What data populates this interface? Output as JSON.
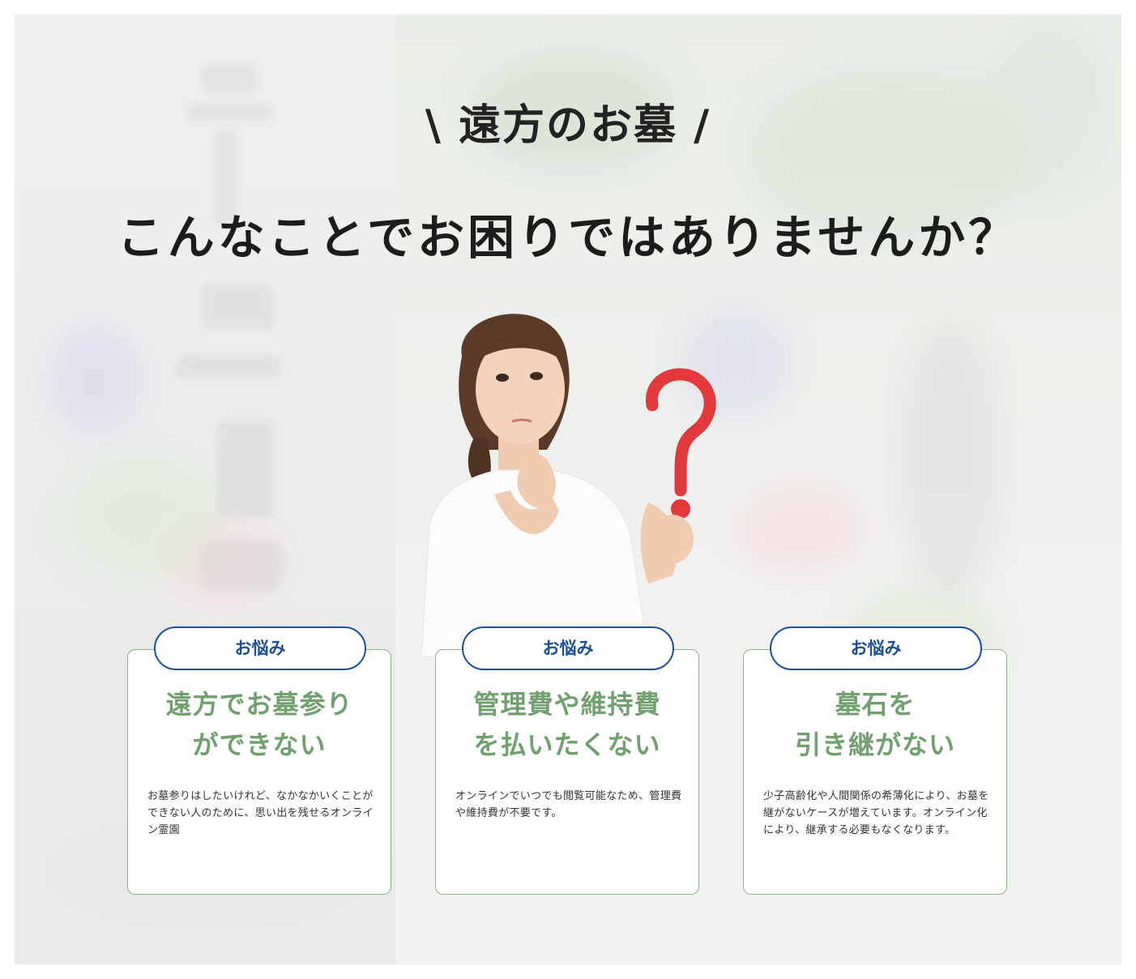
{
  "section": {
    "kicker": "\\ 遠方のお墓 /",
    "headline": "こんなことでお困りではありませんか？"
  },
  "cards": [
    {
      "tag": "お悩み",
      "title_line1": "遠方でお墓参り",
      "title_line2": "ができない",
      "body": "お墓参りはしたいけれど、なかなかいくことができない人のために、思い出を残せるオンライン霊園"
    },
    {
      "tag": "お悩み",
      "title_line1": "管理費や維持費",
      "title_line2": "を払いたくない",
      "body": "オンラインでいつでも閲覧可能なため、管理費や維持費が不要です。"
    },
    {
      "tag": "お悩み",
      "title_line1": "墓石を",
      "title_line2": "引き継がない",
      "body": "少子高齢化や人間関係の希薄化により、お墓を継がないケースが増えています。オンライン化により、継承する必要もなくなります。"
    }
  ],
  "colors": {
    "tag_blue": "#1d4e9c",
    "title_green": "#6fa06d",
    "card_border": "#8fb08c",
    "question_mark_red": "#e2393c"
  },
  "icons": {
    "illustration": "woman-with-question-mark"
  }
}
